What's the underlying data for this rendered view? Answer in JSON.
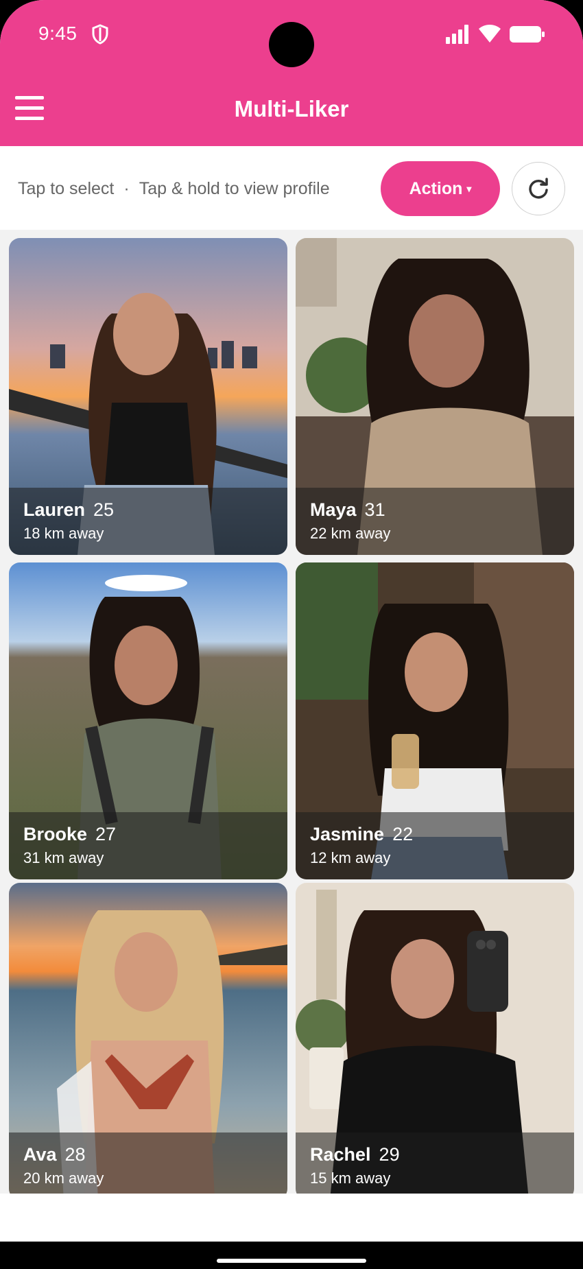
{
  "status_bar": {
    "time": "9:45"
  },
  "app_bar": {
    "title": "Multi-Liker"
  },
  "toolbar": {
    "hint_select": "Tap to select",
    "hint_separator": "·",
    "hint_profile": "Tap & hold to view profile",
    "action_label": "Action",
    "action_caret": "▾"
  },
  "profiles": [
    {
      "name": "Lauren",
      "age": "25",
      "distance": "18 km away"
    },
    {
      "name": "Maya",
      "age": "31",
      "distance": "22 km away"
    },
    {
      "name": "Brooke",
      "age": "27",
      "distance": "31 km away"
    },
    {
      "name": "Jasmine",
      "age": "22",
      "distance": "12 km away"
    },
    {
      "name": "Ava",
      "age": "28",
      "distance": "20 km away"
    },
    {
      "name": "Rachel",
      "age": "29",
      "distance": "15 km away"
    }
  ],
  "colors": {
    "accent": "#ec3f8e"
  }
}
